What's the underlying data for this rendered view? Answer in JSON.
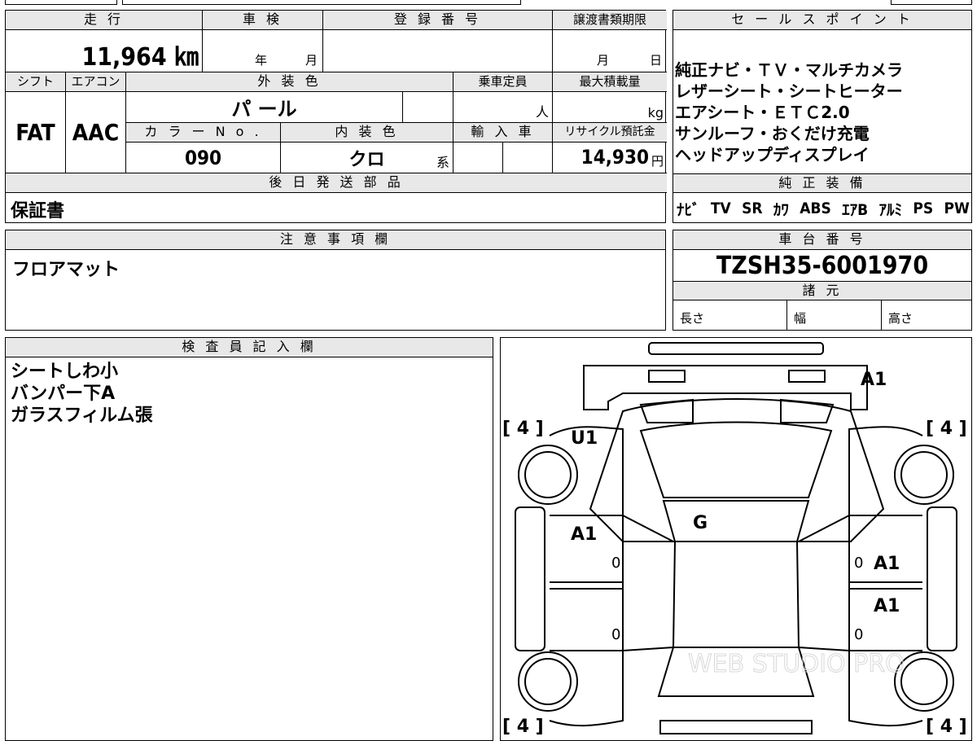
{
  "top": {
    "headers": {
      "mileage": "走 行",
      "shaken": "車 検",
      "registration_no": "登 録 番 号",
      "transfer_deadline": "譲渡書類期限",
      "sales_point": "セ ー ル ス ポ イ ン ト",
      "shift": "シフト",
      "aircon": "エアコン",
      "exterior_color": "外 装 色",
      "capacity": "乗車定員",
      "max_load": "最大積載量",
      "color_no": "カ ラ ー N o .",
      "interior_color": "内 装 色",
      "import": "輸 入 車",
      "recycle": "リサイクル預託金",
      "later_parts": "後 日 発 送 部 品",
      "genuine_equipment": "純 正 装 備",
      "notes": "注 意 事 項 欄",
      "chassis_no": "車 台 番 号",
      "specs": "諸 元",
      "inspector": "検 査 員 記 入 欄"
    },
    "mileage_value": "11,964 ㎞",
    "shaken_year": "年",
    "shaken_month": "月",
    "deadline_month": "月",
    "deadline_day": "日",
    "shift_value": "FAT",
    "aircon_value": "AAC",
    "exterior_color_value": "パ ール",
    "capacity_unit": "人",
    "load_unit": "kg",
    "color_no_value": "090",
    "interior_color_value": "クロ",
    "interior_suffix": "系",
    "recycle_value": "14,930",
    "recycle_unit": "円",
    "later_parts_value": "保証書",
    "notes_value": "フロアマット",
    "chassis_no_value": "TZSH35-6001970",
    "spec_length": "長さ",
    "spec_width": "幅",
    "spec_height": "高さ"
  },
  "sales_points": [
    "純正ナビ・ＴＶ・マルチカメラ",
    "レザーシート・シートヒーター",
    "エアシート・ＥＴＣ2.0",
    "サンルーフ・おくだけ充電",
    "ヘッドアップディスプレイ"
  ],
  "equipment": [
    "ﾅﾋﾞ",
    "TV",
    "SR",
    "ｶﾜ",
    "ABS",
    "ｴｱB",
    "ｱﾙﾐ",
    "PS",
    "PW"
  ],
  "inspector_lines": [
    "シートしわ小",
    "バンパー下A",
    "ガラスフィルム張"
  ],
  "diagram": {
    "tires": [
      "[ 4 ]",
      "[ 4 ]",
      "[ 4 ]",
      "[ 4 ]"
    ],
    "marks": [
      "A1",
      "U1",
      "G",
      "A1",
      "A1",
      "A1"
    ],
    "zeros": [
      "0",
      "0",
      "0",
      "0"
    ],
    "watermark": "WEB STUDIO PRO"
  }
}
